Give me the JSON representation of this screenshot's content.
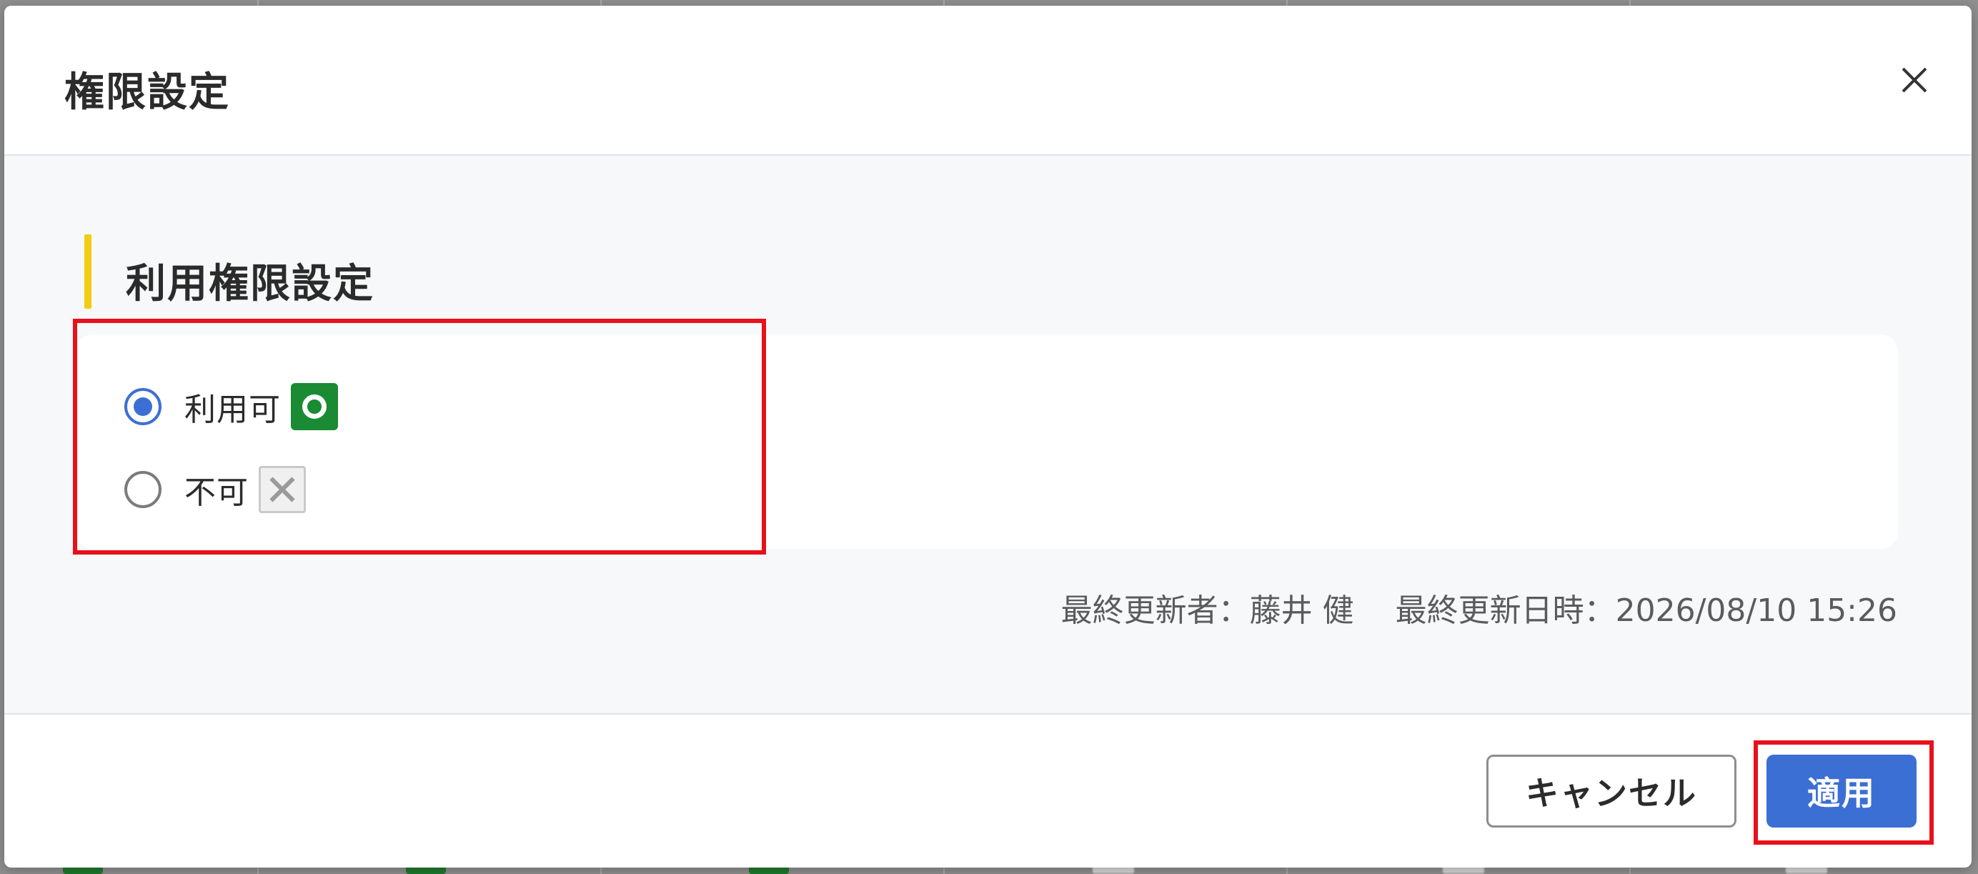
{
  "dialog": {
    "title": "権限設定",
    "close_icon": "close-icon"
  },
  "section": {
    "title": "利用権限設定",
    "accent_color": "#f1cc13"
  },
  "options": [
    {
      "label": "利用可",
      "selected": true,
      "mark_icon": "circle-mark-icon",
      "mark_color": "#1a8a33"
    },
    {
      "label": "不可",
      "selected": false,
      "mark_icon": "cross-mark-icon",
      "mark_color": "#9a9a9a"
    }
  ],
  "meta": {
    "updated_by_label": "最終更新者：",
    "updated_by": "藤井 健",
    "updated_at_label": "最終更新日時：",
    "updated_at": "2026/08/10 15:26"
  },
  "footer": {
    "cancel_label": "キャンセル",
    "apply_label": "適用",
    "apply_color": "#3c6fd4"
  },
  "annotations": {
    "highlight_color": "#e8101a"
  }
}
